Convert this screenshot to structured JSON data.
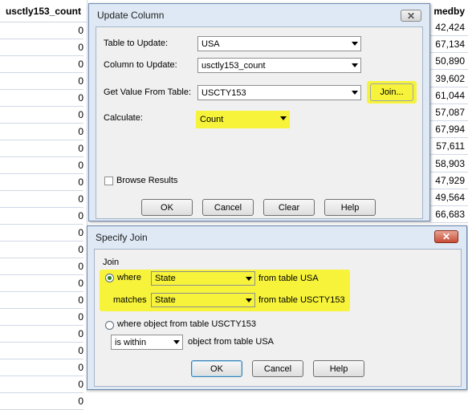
{
  "spreadsheet": {
    "left_header": "usctly153_count",
    "left_values": [
      "0",
      "0",
      "0",
      "0",
      "0",
      "0",
      "0",
      "0",
      "0",
      "0",
      "0",
      "0",
      "0",
      "0",
      "0",
      "0",
      "0",
      "0",
      "0",
      "0",
      "0",
      "0",
      "0"
    ],
    "right_header": "medby",
    "right_values": [
      "42,424",
      "67,134",
      "50,890",
      "39,602",
      "61,044",
      "57,087",
      "67,994",
      "57,611",
      "58,903",
      "47,929",
      "49,564",
      "66,683"
    ]
  },
  "update_dialog": {
    "title": "Update Column",
    "close_glyph": "✕",
    "table_label": "Table to Update:",
    "table_value": "USA",
    "column_label": "Column to Update:",
    "column_value": "usctly153_count",
    "getvalue_label": "Get Value From Table:",
    "getvalue_value": "USCTY153",
    "join_button": "Join...",
    "calc_label": "Calculate:",
    "calc_value": "Count",
    "browse_label": "Browse Results",
    "ok": "OK",
    "cancel": "Cancel",
    "clear": "Clear",
    "help": "Help"
  },
  "join_dialog": {
    "title": "Specify Join",
    "close_glyph": "✕",
    "group_label": "Join",
    "where_label": "where",
    "where_value": "State",
    "from_table_usa": "from table USA",
    "matches_label": "matches",
    "matches_value": "State",
    "from_table_uscty": "from table USCTY153",
    "where_object_label": "where object from table USCTY153",
    "within_value": "is within",
    "object_from_usa": "object from table USA",
    "ok": "OK",
    "cancel": "Cancel",
    "help": "Help"
  },
  "colors": {
    "highlight": "#f6f33a",
    "dialog_frame": "#dfe9f5"
  }
}
